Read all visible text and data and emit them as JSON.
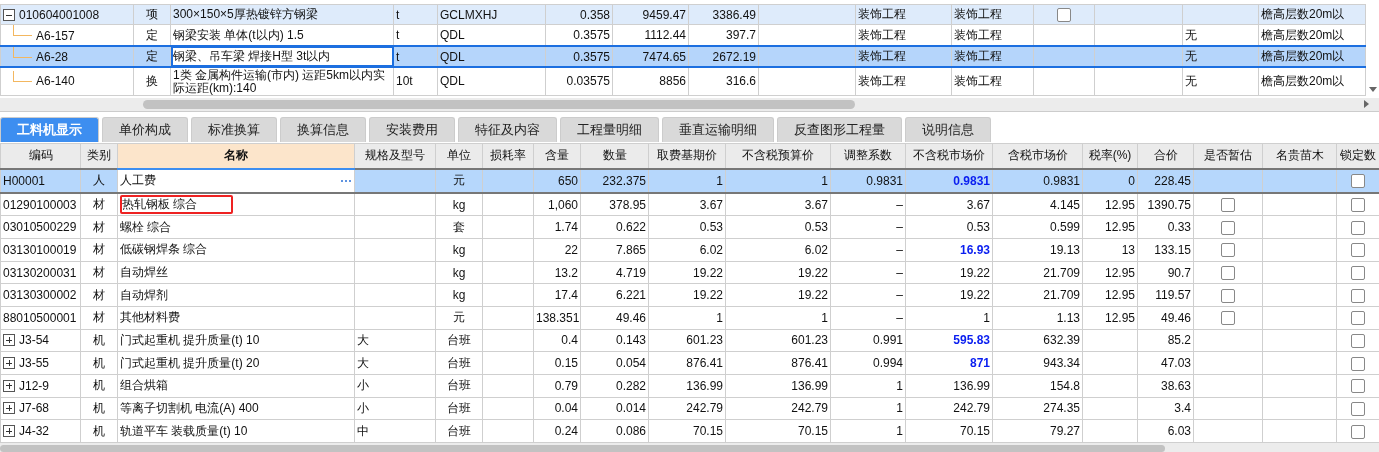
{
  "top_grid": {
    "rows": [
      {
        "expanded": true,
        "selected": false,
        "column_1": "010604001008",
        "column_2": "项",
        "column_3": "300×150×5厚热镀锌方钢梁",
        "column_4": "t",
        "column_5": "GCLMXHJ",
        "column_6": "0.358",
        "column_7": "9459.47",
        "column_8": "3386.49",
        "column_10": "装饰工程",
        "column_11": "装饰工程",
        "column_12_checked": false,
        "column_15": "檐高层数20m以",
        "children": [
          {
            "selected": false,
            "column_1": "A6-157",
            "column_2": "定",
            "column_3": "钢梁安装 单体(t以内) 1.5",
            "column_4": "t",
            "column_5": "QDL",
            "column_6": "0.3575",
            "column_7": "1112.44",
            "column_8": "397.7",
            "column_10": "装饰工程",
            "column_11": "装饰工程",
            "column_14": "无",
            "column_15": "檐高层数20m以"
          },
          {
            "selected": true,
            "column_1": "A6-28",
            "column_2": "定",
            "column_3": "钢梁、吊车梁 焊接H型 3t以内",
            "column_4": "t",
            "column_5": "QDL",
            "column_6": "0.3575",
            "column_7": "7474.65",
            "column_8": "2672.19",
            "column_10": "装饰工程",
            "column_11": "装饰工程",
            "column_14": "无",
            "column_15": "檐高层数20m以"
          },
          {
            "selected": false,
            "column_1": "A6-140",
            "column_2": "换",
            "column_3": "1类 金属构件运输(市内) 运距5km以内实际运距(km):140",
            "column_4": "10t",
            "column_5": "QDL",
            "column_6": "0.03575",
            "column_7": "8856",
            "column_8": "316.6",
            "column_10": "装饰工程",
            "column_11": "装饰工程",
            "column_14": "无",
            "column_15": "檐高层数20m以"
          }
        ]
      }
    ]
  },
  "tabs": [
    {
      "label": "工料机显示",
      "selected": true
    },
    {
      "label": "单价构成",
      "selected": false
    },
    {
      "label": "标准换算",
      "selected": false
    },
    {
      "label": "换算信息",
      "selected": false
    },
    {
      "label": "安装费用",
      "selected": false
    },
    {
      "label": "特征及内容",
      "selected": false
    },
    {
      "label": "工程量明细",
      "selected": false
    },
    {
      "label": "垂直运输明细",
      "selected": false
    },
    {
      "label": "反查图形工程量",
      "selected": false
    },
    {
      "label": "说明信息",
      "selected": false
    }
  ],
  "resource_grid": {
    "columns": [
      {
        "label": "编码",
        "selected": false
      },
      {
        "label": "类别",
        "selected": false
      },
      {
        "label": "名称",
        "selected": true
      },
      {
        "label": "规格及型号",
        "selected": false
      },
      {
        "label": "单位",
        "selected": false
      },
      {
        "label": "损耗率",
        "selected": false
      },
      {
        "label": "含量",
        "selected": false
      },
      {
        "label": "数量",
        "selected": false
      },
      {
        "label": "取费基期价",
        "selected": false
      },
      {
        "label": "不含税预算价",
        "selected": false
      },
      {
        "label": "调整系数",
        "selected": false
      },
      {
        "label": "不含税市场价",
        "selected": false
      },
      {
        "label": "含税市场价",
        "selected": false
      },
      {
        "label": "税率(%)",
        "selected": false
      },
      {
        "label": "合价",
        "selected": false
      },
      {
        "label": "是否暂估",
        "selected": false
      },
      {
        "label": "名贵苗木",
        "selected": false
      },
      {
        "label": "锁定数",
        "selected": false
      }
    ],
    "rows": [
      {
        "selected": true,
        "outlined": false,
        "price_changed": true,
        "code": "H00001",
        "category": "人",
        "name": "人工费",
        "unit": "元",
        "content": "650",
        "quantity": "232.375",
        "base_price": "1",
        "budget_price": "1",
        "factor": "0.9831",
        "market_price": "0.9831",
        "market_price_tax": "0.9831",
        "tax_rate": "0",
        "total": "228.45",
        "locked": false
      },
      {
        "selected": false,
        "outlined": true,
        "price_changed": false,
        "code": "01290100003",
        "category": "材",
        "name": "热轧钢板 综合",
        "unit": "kg",
        "content": "1,060",
        "quantity": "378.95",
        "base_price": "3.67",
        "budget_price": "3.67",
        "factor": "–",
        "market_price": "3.67",
        "market_price_tax": "4.145",
        "tax_rate": "12.95",
        "total": "1390.75",
        "provisional": false,
        "locked": false
      },
      {
        "selected": false,
        "outlined": false,
        "price_changed": false,
        "code": "03010500229",
        "category": "材",
        "name": "螺栓 综合",
        "unit": "套",
        "content": "1.74",
        "quantity": "0.622",
        "base_price": "0.53",
        "budget_price": "0.53",
        "factor": "–",
        "market_price": "0.53",
        "market_price_tax": "0.599",
        "tax_rate": "12.95",
        "total": "0.33",
        "provisional": false,
        "locked": false
      },
      {
        "selected": false,
        "outlined": false,
        "price_changed": true,
        "code": "03130100019",
        "category": "材",
        "name": "低碳钢焊条 综合",
        "unit": "kg",
        "content": "22",
        "quantity": "7.865",
        "base_price": "6.02",
        "budget_price": "6.02",
        "factor": "–",
        "market_price": "16.93",
        "market_price_tax": "19.13",
        "tax_rate": "13",
        "total": "133.15",
        "provisional": false,
        "locked": false
      },
      {
        "selected": false,
        "outlined": false,
        "price_changed": false,
        "code": "03130200031",
        "category": "材",
        "name": "自动焊丝",
        "unit": "kg",
        "content": "13.2",
        "quantity": "4.719",
        "base_price": "19.22",
        "budget_price": "19.22",
        "factor": "–",
        "market_price": "19.22",
        "market_price_tax": "21.709",
        "tax_rate": "12.95",
        "total": "90.7",
        "provisional": false,
        "locked": false
      },
      {
        "selected": false,
        "outlined": false,
        "price_changed": false,
        "code": "03130300002",
        "category": "材",
        "name": "自动焊剂",
        "unit": "kg",
        "content": "17.4",
        "quantity": "6.221",
        "base_price": "19.22",
        "budget_price": "19.22",
        "factor": "–",
        "market_price": "19.22",
        "market_price_tax": "21.709",
        "tax_rate": "12.95",
        "total": "119.57",
        "provisional": false,
        "locked": false
      },
      {
        "selected": false,
        "outlined": false,
        "price_changed": false,
        "code": "88010500001",
        "category": "材",
        "name": "其他材料费",
        "unit": "元",
        "content": "138.351",
        "quantity": "49.46",
        "base_price": "1",
        "budget_price": "1",
        "factor": "–",
        "market_price": "1",
        "market_price_tax": "1.13",
        "tax_rate": "12.95",
        "total": "49.46",
        "provisional": false,
        "locked": false
      },
      {
        "selected": false,
        "outlined": false,
        "price_changed": true,
        "expanded": false,
        "code": "J3-54",
        "category": "机",
        "name": "门式起重机 提升质量(t) 10",
        "spec": "大",
        "unit": "台班",
        "content": "0.4",
        "quantity": "0.143",
        "base_price": "601.23",
        "budget_price": "601.23",
        "factor": "0.991",
        "market_price": "595.83",
        "market_price_tax": "632.39",
        "total": "85.2",
        "locked": false
      },
      {
        "selected": false,
        "outlined": false,
        "price_changed": true,
        "expanded": false,
        "code": "J3-55",
        "category": "机",
        "name": "门式起重机 提升质量(t) 20",
        "spec": "大",
        "unit": "台班",
        "content": "0.15",
        "quantity": "0.054",
        "base_price": "876.41",
        "budget_price": "876.41",
        "factor": "0.994",
        "market_price": "871",
        "market_price_tax": "943.34",
        "total": "47.03",
        "locked": false
      },
      {
        "selected": false,
        "outlined": false,
        "price_changed": false,
        "expanded": false,
        "code": "J12-9",
        "category": "机",
        "name": "组合烘箱",
        "spec": "小",
        "unit": "台班",
        "content": "0.79",
        "quantity": "0.282",
        "base_price": "136.99",
        "budget_price": "136.99",
        "factor": "1",
        "market_price": "136.99",
        "market_price_tax": "154.8",
        "total": "38.63",
        "locked": false
      },
      {
        "selected": false,
        "outlined": false,
        "price_changed": false,
        "expanded": false,
        "code": "J7-68",
        "category": "机",
        "name": "等离子切割机 电流(A) 400",
        "spec": "小",
        "unit": "台班",
        "content": "0.04",
        "quantity": "0.014",
        "base_price": "242.79",
        "budget_price": "242.79",
        "factor": "1",
        "market_price": "242.79",
        "market_price_tax": "274.35",
        "total": "3.4",
        "locked": false
      },
      {
        "selected": false,
        "outlined": false,
        "price_changed": false,
        "expanded": false,
        "code": "J4-32",
        "category": "机",
        "name": "轨道平车 装载质量(t) 10",
        "spec": "中",
        "unit": "台班",
        "content": "0.24",
        "quantity": "0.086",
        "base_price": "70.15",
        "budget_price": "70.15",
        "factor": "1",
        "market_price": "70.15",
        "market_price_tax": "79.27",
        "total": "6.03",
        "locked": false
      }
    ]
  }
}
